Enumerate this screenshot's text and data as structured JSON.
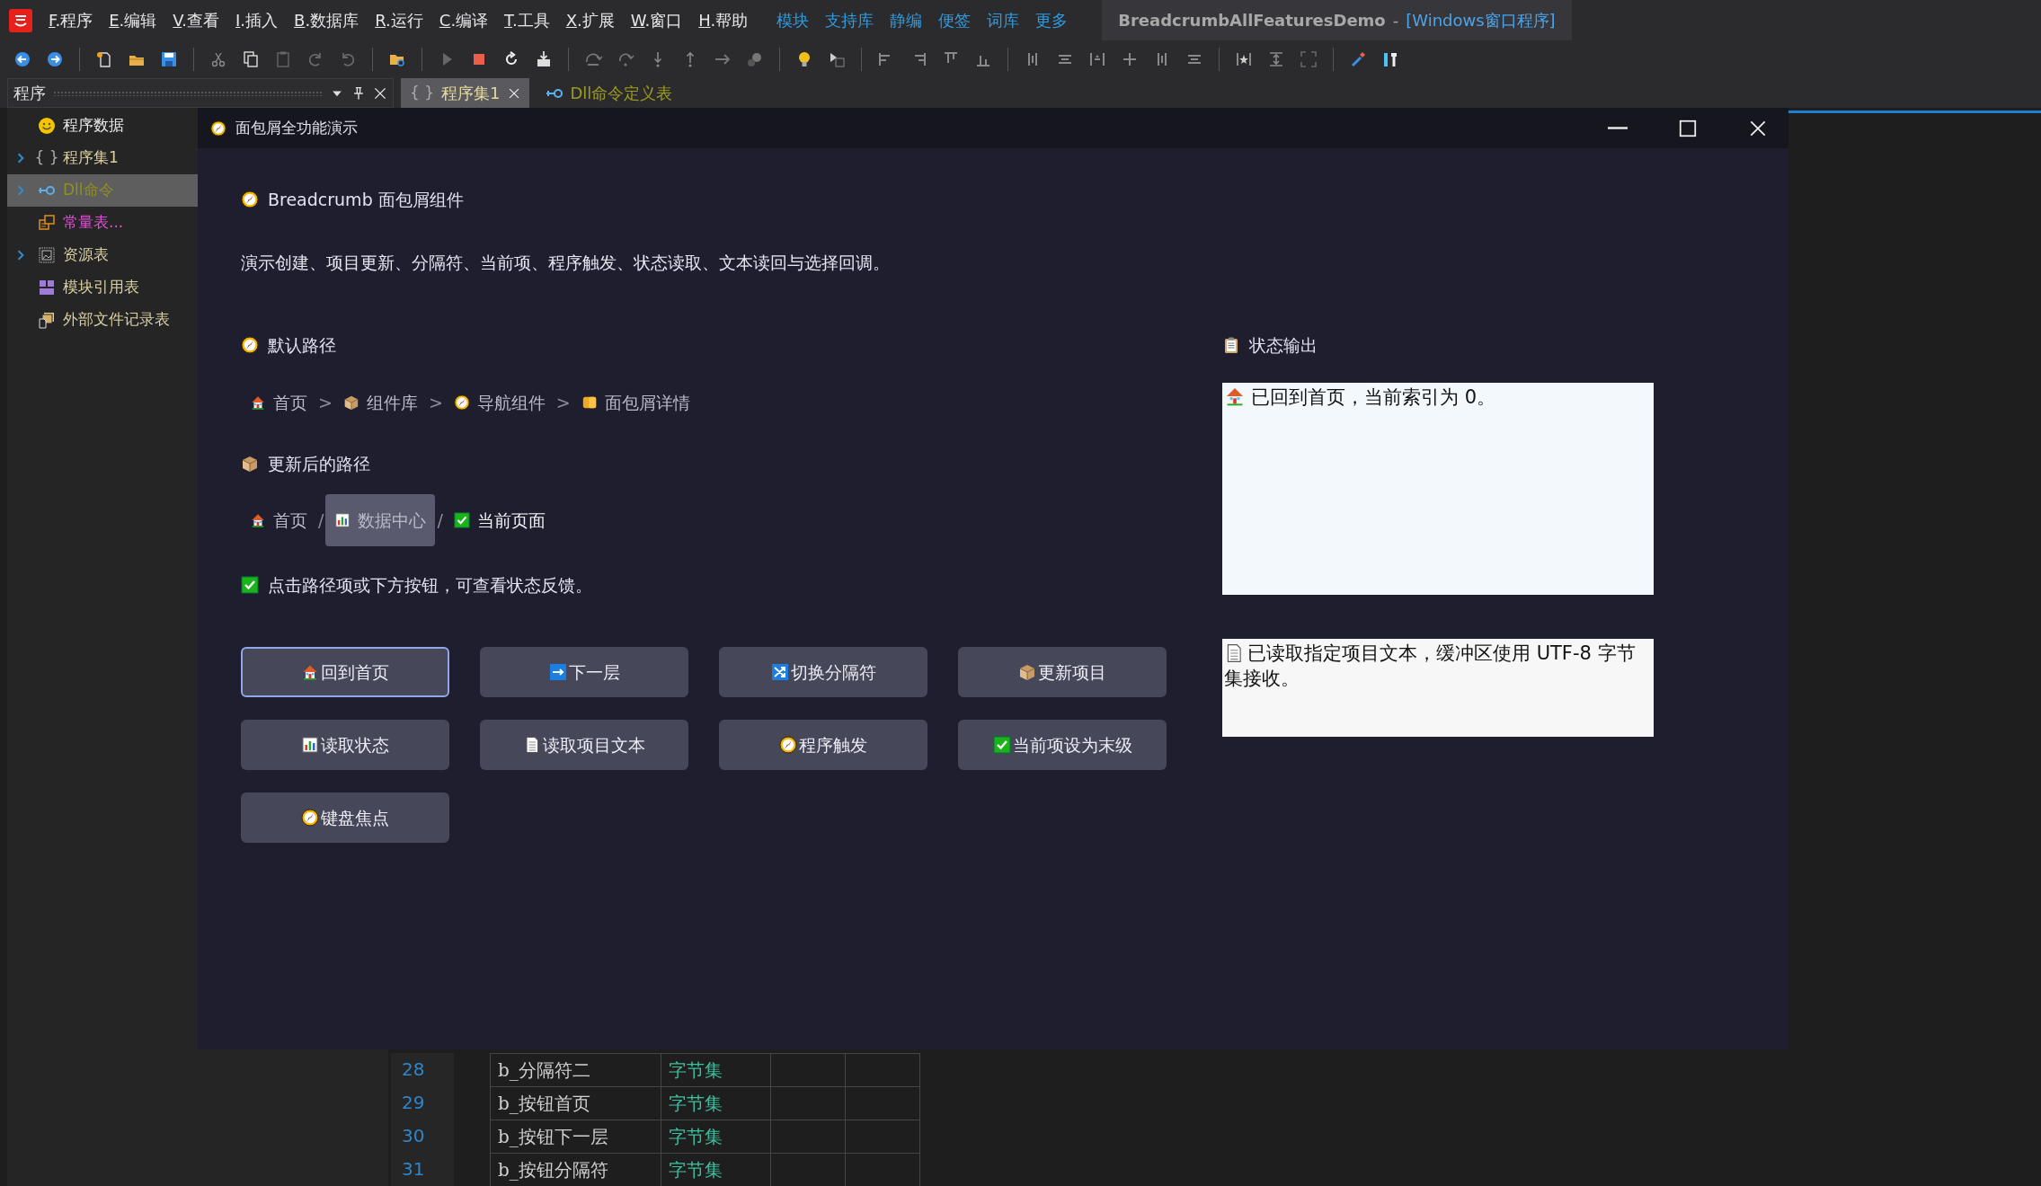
{
  "menu": {
    "items": [
      "F.程序",
      "E.编辑",
      "V.查看",
      "I.插入",
      "B.数据库",
      "R.运行",
      "C.编译",
      "T.工具",
      "X.扩展",
      "W.窗口",
      "H.帮助"
    ],
    "links": [
      "模块",
      "支持库",
      "静编",
      "便签",
      "词库",
      "更多"
    ]
  },
  "app_title": {
    "name": "BreadcrumbAllFeaturesDemo",
    "separator": "-",
    "type": "[Windows窗口程序]"
  },
  "panel": {
    "title": "程序",
    "tree": [
      {
        "label": "程序数据",
        "expandable": false,
        "selected": false,
        "color": "#e8e8e8"
      },
      {
        "label": "程序集1",
        "glyph": "{ }",
        "expandable": true,
        "selected": false,
        "color": "#d9cfa0"
      },
      {
        "label": "Dll命令",
        "expandable": true,
        "selected": true,
        "color": "#8f8f24"
      },
      {
        "label": "常量表...",
        "expandable": false,
        "selected": false,
        "color": "#e04fd8"
      },
      {
        "label": "资源表",
        "expandable": true,
        "selected": false,
        "color": "#d9cfa0"
      },
      {
        "label": "模块引用表",
        "expandable": false,
        "selected": false,
        "color": "#d9cfa0"
      },
      {
        "label": "外部文件记录表",
        "expandable": false,
        "selected": false,
        "color": "#d9cfa0"
      }
    ]
  },
  "editor_tabs": [
    {
      "label": "程序集1",
      "glyph": "{ }",
      "selected": true,
      "closable": true
    },
    {
      "label": "Dll命令定义表",
      "selected": false,
      "closable": false
    }
  ],
  "dialog": {
    "title": "面包屑全功能演示",
    "heading": "Breadcrumb 面包屑组件",
    "description": "演示创建、项目更新、分隔符、当前项、程序触发、状态读取、文本读回与选择回调。",
    "default_path": {
      "label": "默认路径",
      "separators": [
        ">",
        ">",
        ">"
      ],
      "items": [
        {
          "label": "首页",
          "hovered": false,
          "current": false
        },
        {
          "label": "组件库",
          "hovered": false,
          "current": false
        },
        {
          "label": "导航组件",
          "hovered": false,
          "current": false
        },
        {
          "label": "面包屑详情",
          "hovered": false,
          "current": false
        }
      ]
    },
    "updated_path": {
      "label": "更新后的路径",
      "separators": [
        "/",
        "/"
      ],
      "items": [
        {
          "label": "首页",
          "hovered": false,
          "current": false
        },
        {
          "label": "数据中心",
          "hovered": true,
          "current": false
        },
        {
          "label": "当前页面",
          "hovered": false,
          "current": true
        }
      ]
    },
    "hint": "点击路径项或下方按钮，可查看状态反馈。",
    "buttons": [
      {
        "label": "回到首页",
        "focused": true
      },
      {
        "label": "下一层",
        "focused": false
      },
      {
        "label": "切换分隔符",
        "focused": false
      },
      {
        "label": "更新项目",
        "focused": false
      },
      {
        "label": "读取状态",
        "focused": false
      },
      {
        "label": "读取项目文本",
        "focused": false
      },
      {
        "label": "程序触发",
        "focused": false
      },
      {
        "label": "当前项设为末级",
        "focused": false
      },
      {
        "label": "键盘焦点",
        "focused": false
      }
    ],
    "status": {
      "label": "状态输出",
      "output": "已回到首页，当前索引为 0。",
      "read_text": "已读取指定项目文本，缓冲区使用 UTF-8 字节集接收。"
    }
  },
  "code_table": {
    "rows": [
      {
        "line": "28",
        "name": "b_分隔符二",
        "type": "字节集"
      },
      {
        "line": "29",
        "name": "b_按钮首页",
        "type": "字节集"
      },
      {
        "line": "30",
        "name": "b_按钮下一层",
        "type": "字节集"
      },
      {
        "line": "31",
        "name": "b_按钮分隔符",
        "type": "字节集"
      }
    ]
  }
}
